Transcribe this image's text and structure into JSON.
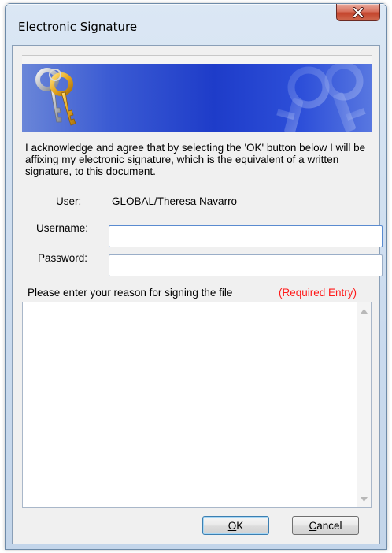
{
  "window": {
    "title": "Electronic Signature"
  },
  "acknowledgement": "I acknowledge and agree that by selecting the 'OK' button below I will be affixing my electronic signature, which is the equivalent of a written signature, to this document.",
  "user": {
    "label": "User:",
    "value": "GLOBAL/Theresa Navarro"
  },
  "username": {
    "label": "Username:",
    "value": ""
  },
  "password": {
    "label": "Password:",
    "value": ""
  },
  "reason": {
    "prompt": "Please enter your reason for signing the file",
    "required_note": "(Required Entry)",
    "value": ""
  },
  "buttons": {
    "ok_label": "OK",
    "cancel_label": "Cancel"
  },
  "icons": {
    "close": "close-icon",
    "keys": "keys-icon",
    "scroll_up": "scroll-up-arrow-icon",
    "scroll_down": "scroll-down-arrow-icon"
  },
  "colors": {
    "banner_blue": "#1e3cc9",
    "required_red": "#ff1a1a",
    "close_button_red": "#c4442c"
  }
}
